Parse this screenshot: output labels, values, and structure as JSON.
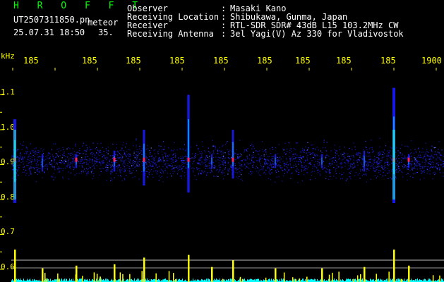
{
  "header": {
    "title": "H R O F F T",
    "filename": "UT2507311850.pn",
    "mode": "meteor",
    "datetime": "25.07.31 18:50",
    "count": "35."
  },
  "info": [
    {
      "label": "Observer",
      "value": "Masaki Kano"
    },
    {
      "label": "Receiving Location",
      "value": "Shibukawa, Gunma, Japan"
    },
    {
      "label": "Receiver",
      "value": "RTL-SDR SDR# 43dB L15 103.2MHz CW"
    },
    {
      "label": "Receiving Antenna",
      "value": "3el Yagi(V) Az 330 for Vladivostok"
    }
  ],
  "axis": {
    "y_unit": "kHz",
    "y_ticks": [
      "1.1",
      "1.0",
      "0.9",
      "0.8",
      "0.7",
      "0.6"
    ],
    "x_ticks": [
      "185",
      "185",
      "185",
      "185",
      "185",
      "185",
      "185",
      "185",
      "185",
      "1900"
    ]
  },
  "colors": {
    "background": "#000000",
    "text": "#ffffff",
    "title": "#00ff00",
    "ticks": "#ffff00",
    "noise": "#1a1aff",
    "echo_low": "#00c8ff",
    "echo_high": "#ff2060",
    "level_high": "#ffff00",
    "level_low": "#00ffff"
  },
  "echoes": [
    {
      "minute": 1850.05,
      "freq_low": 0.79,
      "freq_high": 1.03,
      "strength": 1.0
    },
    {
      "minute": 1850.7,
      "freq_low": 0.88,
      "freq_high": 0.93,
      "strength": 0.3
    },
    {
      "minute": 1851.5,
      "freq_low": 0.89,
      "freq_high": 0.93,
      "strength": 0.4
    },
    {
      "minute": 1852.4,
      "freq_low": 0.88,
      "freq_high": 0.94,
      "strength": 0.45
    },
    {
      "minute": 1853.1,
      "freq_low": 0.84,
      "freq_high": 1.0,
      "strength": 0.7
    },
    {
      "minute": 1854.15,
      "freq_low": 0.82,
      "freq_high": 1.1,
      "strength": 0.8
    },
    {
      "minute": 1854.7,
      "freq_low": 0.89,
      "freq_high": 0.93,
      "strength": 0.35
    },
    {
      "minute": 1855.2,
      "freq_low": 0.86,
      "freq_high": 1.0,
      "strength": 0.6
    },
    {
      "minute": 1856.2,
      "freq_low": 0.89,
      "freq_high": 0.93,
      "strength": 0.3
    },
    {
      "minute": 1857.3,
      "freq_low": 0.89,
      "freq_high": 0.93,
      "strength": 0.3
    },
    {
      "minute": 1858.3,
      "freq_low": 0.88,
      "freq_high": 0.94,
      "strength": 0.35
    },
    {
      "minute": 1859.0,
      "freq_low": 0.79,
      "freq_high": 1.12,
      "strength": 1.0
    },
    {
      "minute": 1859.35,
      "freq_low": 0.89,
      "freq_high": 0.93,
      "strength": 0.4
    }
  ]
}
